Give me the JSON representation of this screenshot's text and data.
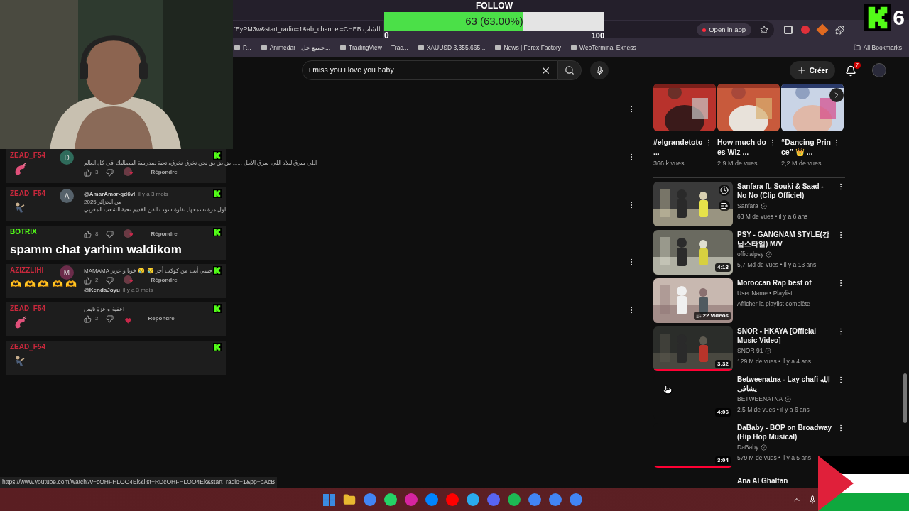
{
  "browser": {
    "address": "'EyPM3w&start_radio=1&ab_channel=CHEB.الشاب",
    "open_in_app": "Open in app",
    "bookmarks": [
      "P...",
      "Animedar - جميع حل...",
      "TradingView — Trac...",
      "XAUUSD 3,355.665...",
      "News | Forex Factory",
      "WebTerminal Exness"
    ],
    "all_bookmarks": "All Bookmarks"
  },
  "youtube": {
    "search_value": "i miss you i love you baby",
    "create_label": "Créer",
    "notifications": "7",
    "shorts": [
      {
        "title": "#elgrandetoto ...",
        "views": "366 k vues"
      },
      {
        "title": "How much does Wiz ...",
        "views": "2,9 M de vues"
      },
      {
        "title": "“Dancing Prince” 👑 ...",
        "views": "2,2 M de vues"
      }
    ],
    "videos": [
      {
        "kind": "video",
        "title": "Sanfara ft. Souki & Saad - No No (Clip Officiel)",
        "channel": "Sanfara",
        "verified": true,
        "meta": "63 M de vues • il y a 6 ans",
        "thumbnail_loaded": true,
        "hover": true
      },
      {
        "kind": "video",
        "title": "PSY - GANGNAM STYLE(강남스타일) M/V",
        "channel": "officialpsy",
        "verified": true,
        "meta": "5,7 Md de vues • il y a 13 ans",
        "duration": "4:13",
        "thumbnail_loaded": true,
        "hover": false
      },
      {
        "kind": "playlist",
        "title": "Moroccan Rap best of",
        "channel": "User Name • Playlist",
        "meta": "Afficher la playlist complète",
        "count": "22 vidéos",
        "thumbnail_loaded": true
      },
      {
        "kind": "video",
        "title": "SNOR - HKAYA [Official Music Video]",
        "channel": "SNOR 91",
        "verified": true,
        "meta": "129 M de vues • il y a 4 ans",
        "duration": "3:32",
        "level": 1,
        "thumbnail_loaded": true,
        "hover": false
      },
      {
        "kind": "video",
        "title": "Betweenatna - Lay chafi الله يشافي",
        "channel": "BETWEENATNA",
        "verified": true,
        "meta": "2,5 M de vues • il y a 6 ans",
        "duration": "4:06",
        "thumbnail_loaded": false,
        "hover": false
      },
      {
        "kind": "video",
        "title": "DaBaby - BOP on Broadway (Hip Hop Musical)",
        "channel": "DaBaby",
        "verified": true,
        "meta": "579 M de vues • il y a 5 ans",
        "duration": "3:04",
        "level": 1,
        "thumbnail_loaded": false,
        "hover": false
      },
      {
        "kind": "cut",
        "title": "Ana Al Ghaltan"
      }
    ],
    "status_url": "https://www.youtube.com/watch?v=cOHFHLOO4Ek&list=RDcOHFHLOO4Ek&start_radio=1&pp=oAcB"
  },
  "goal": {
    "title": "FOLLOW",
    "reading": "63 (63.00%)",
    "level": 0.63,
    "min": "0",
    "max": "100"
  },
  "counter": "6",
  "chat": [
    {
      "user": "ZEAD_F54",
      "color": "#c8283c",
      "body": {
        "kind": "shrimp"
      },
      "comment": {
        "avatar": {
          "letter": "D",
          "color": "#2f6b5b"
        },
        "items": [
          {
            "kind": "line",
            "text": "اللي سرق لبلاد اللي سرق الأمل ...... بق بق بق نحن نخرق نخرق، تحية لمدرسة السماليك في كل العالم"
          },
          {
            "kind": "actions",
            "likes": "3",
            "heart": {
              "kind": "avatar"
            },
            "reply": "Répondre"
          }
        ]
      }
    },
    {
      "user": "ZEAD_F54",
      "color": "#c8283c",
      "body": {
        "kind": "dancer"
      },
      "comment": {
        "avatar": {
          "letter": "A",
          "color": "#56626b"
        },
        "items": [
          {
            "kind": "author",
            "name": "@AmarAmar-gd6vl",
            "time": "il y a 3 mois"
          },
          {
            "kind": "line",
            "text": "من الجزائر 2025"
          },
          {
            "kind": "line",
            "text": "اول مرة نسمعها, تقاوة سوت الفن القديم تحية الشعب المغربي"
          }
        ]
      }
    },
    {
      "user": "BOTRIX",
      "color": "#53fc18",
      "body": {
        "kind": "text",
        "text": "spamm chat yarhim waldikom"
      },
      "comment": {
        "items": [
          {
            "kind": "actions",
            "likes": "8",
            "heart": {
              "kind": "avatar"
            },
            "reply": "Répondre"
          }
        ]
      }
    },
    {
      "user": "AZIZZLIHI",
      "color": "#c8283c",
      "body": {
        "kind": "emoji",
        "text": "🫶 🫶 🫶 🫶 🫶"
      },
      "comment": {
        "avatar": {
          "letter": "M",
          "color": "#6b2c4a"
        },
        "items": [
          {
            "kind": "line",
            "text": "MAMAMA حبيبي أنت من كوكب أخر 😢 😢 خويا و عزيز"
          },
          {
            "kind": "actions",
            "likes": "2",
            "heart": {
              "kind": "avatar"
            },
            "reply": "Répondre"
          },
          {
            "kind": "author",
            "name": "@KendaJoyu",
            "time": "il y a 3 mois"
          }
        ]
      }
    },
    {
      "user": "ZEAD_F54",
      "color": "#c8283c",
      "body": {
        "kind": "shrimp"
      },
      "comment": {
        "items": [
          {
            "kind": "line",
            "text": "اعفية و عزة نايس"
          },
          {
            "kind": "actions",
            "likes": "2",
            "heart": {
              "kind": "plain"
            },
            "reply": "Répondre"
          }
        ]
      }
    },
    {
      "user": "ZEAD_F54",
      "color": "#c8283c",
      "body": {
        "kind": "dancer"
      }
    }
  ]
}
